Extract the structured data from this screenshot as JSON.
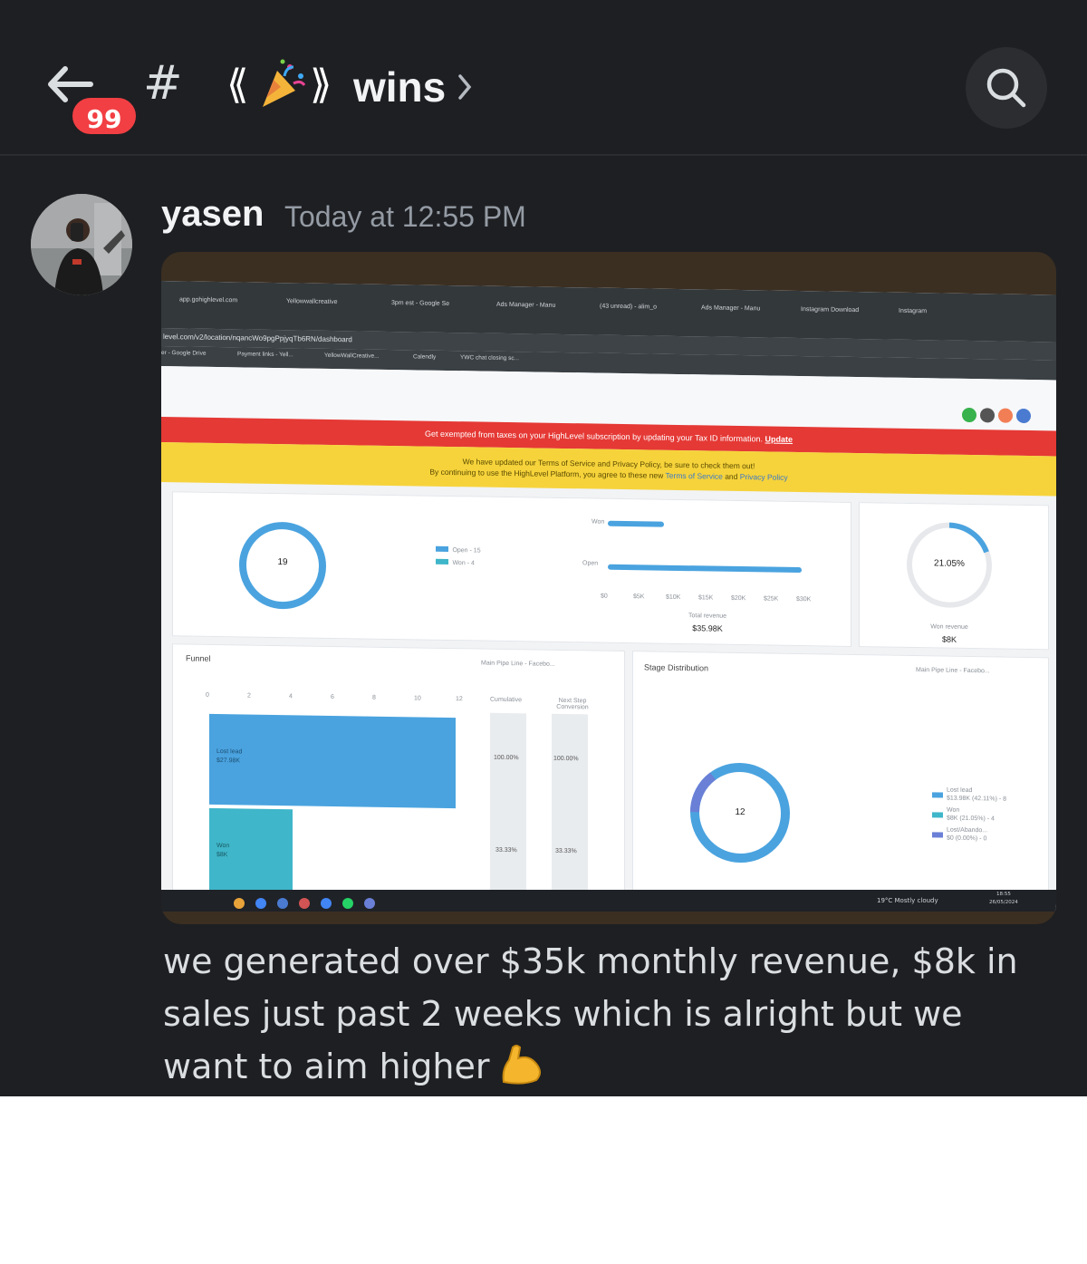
{
  "header": {
    "unread_count": "99",
    "channel_prefix": "⟪",
    "channel_suffix": "⟫",
    "channel_name": "wins",
    "icons": [
      "back-arrow-icon",
      "hash-icon",
      "party-popper-icon",
      "chevron-right-icon",
      "search-icon"
    ]
  },
  "message": {
    "author": "yasen",
    "timestamp": "Today at 12:55 PM",
    "text": "we generated over $35k monthly revenue, $8k in sales just past 2 weeks which is alright but we want to aim higher",
    "emoji": "flexed-biceps-icon"
  },
  "photo": {
    "tabs": [
      "app.gohighlevel.com",
      "Yellowwallcreative",
      "3pm est - Google Se",
      "Ads Manager - Manu",
      "(43 unread) - alim_o",
      "Ads Manager - Manu",
      "Instagram Download",
      "Instagram"
    ],
    "url": "level.com/v2/location/nqancWo9pgPpjyqTb6RN/dashboard",
    "bookmarks": [
      "er - Google Drive",
      "Payment links - Yell...",
      "YellowWallCreative...",
      "Calendly",
      "YWC chat closing sc..."
    ],
    "banner_red": "Get exempted from taxes on your HighLevel subscription by updating your Tax ID information.",
    "banner_red_link": "Update",
    "banner_yellow_1": "We have updated our Terms of Service and Privacy Policy, be sure to check them out!",
    "banner_yellow_2": "By continuing to use the HighLevel Platform, you agree to these new",
    "banner_yellow_link1": "Terms of Service",
    "banner_yellow_and": "and",
    "banner_yellow_link2": "Privacy Policy",
    "opportunities_total": "19",
    "legend_open": "Open - 15",
    "legend_won": "Won - 4",
    "bar_won_label": "Won",
    "bar_open_label": "Open",
    "revenue_ticks": [
      "$0",
      "$5K",
      "$10K",
      "$15K",
      "$20K",
      "$25K",
      "$30K"
    ],
    "total_revenue_label": "Total revenue",
    "total_revenue": "$35.98K",
    "conversion_rate": "21.05%",
    "won_revenue_label": "Won revenue",
    "won_revenue": "$8K",
    "funnel_title": "Funnel",
    "funnel_ticks": [
      "0",
      "2",
      "4",
      "6",
      "8",
      "10",
      "12"
    ],
    "pipeline_select": "Main Pipe Line - Facebo...",
    "col_cumulative": "Cumulative",
    "col_next_step": "Next Step Conversion",
    "pct_100_a": "100.00%",
    "pct_100_b": "100.00%",
    "pct_33_a": "33.33%",
    "pct_33_b": "33.33%",
    "funnel_lost_label": "Lost lead",
    "funnel_lost_value": "$27.98K",
    "funnel_won_label": "Won",
    "funnel_won_value": "$8K",
    "stage_title": "Stage Distribution",
    "stage_select": "Main Pipe Line - Facebo...",
    "stage_total": "12",
    "stage_legend": [
      {
        "name": "Lost lead",
        "detail": "$13.98K (42.11%) - 8"
      },
      {
        "name": "Won",
        "detail": "$8K (21.05%) - 4"
      },
      {
        "name": "Lost/Abando...",
        "detail": "$0 (0.00%) - 0"
      }
    ],
    "weather": "19°C Mostly cloudy",
    "taskbar_time": "18:55",
    "taskbar_date": "26/05/2024"
  },
  "colors": {
    "discord_bg": "#1e1f22",
    "badge_red": "#f23f43",
    "chart_blue": "#4aa3df",
    "chart_teal": "#3fb6c9"
  }
}
